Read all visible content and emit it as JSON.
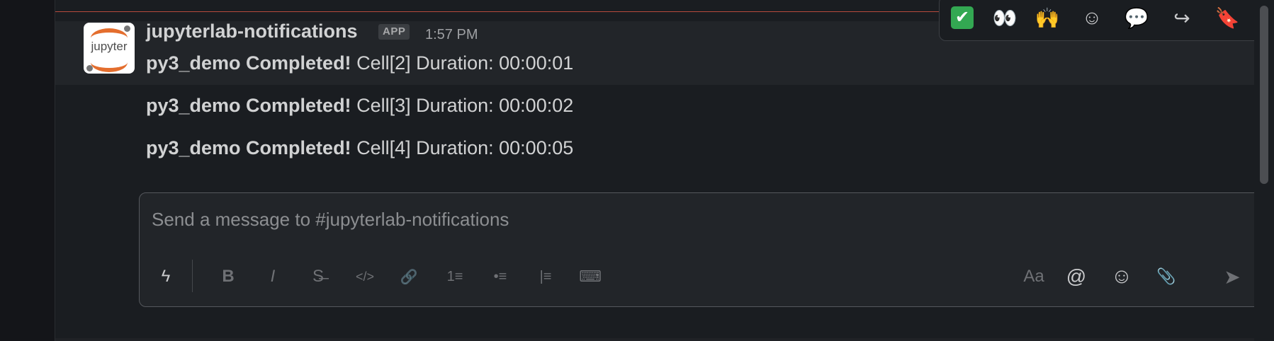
{
  "message_group": {
    "sender": "jupyterlab-notifications",
    "badge": "APP",
    "time": "1:57 PM",
    "avatar_text": "jupyter",
    "messages": [
      {
        "bold": "py3_demo Completed!",
        "text": " Cell[2] Duration: 00:00:01"
      },
      {
        "bold": "py3_demo Completed!",
        "text": " Cell[3] Duration: 00:00:02"
      },
      {
        "bold": "py3_demo Completed!",
        "text": " Cell[4] Duration: 00:00:05"
      }
    ]
  },
  "hover_actions": [
    {
      "name": "check-mark-reaction",
      "glyph": "✔"
    },
    {
      "name": "eyes-reaction",
      "glyph": "👀"
    },
    {
      "name": "raised-hands-reaction",
      "glyph": "🙌"
    },
    {
      "name": "add-reaction",
      "glyph": "☺"
    },
    {
      "name": "reply-in-thread",
      "glyph": "💬"
    },
    {
      "name": "share-message",
      "glyph": "↪"
    },
    {
      "name": "save-for-later",
      "glyph": "🔖"
    },
    {
      "name": "more-actions",
      "glyph": "⋮"
    }
  ],
  "composer": {
    "placeholder": "Send a message to #jupyterlab-notifications",
    "tools": [
      {
        "name": "shortcuts-icon",
        "glyph": "ϟ"
      },
      {
        "name": "bold-icon",
        "glyph": "B"
      },
      {
        "name": "italic-icon",
        "glyph": "I"
      },
      {
        "name": "strikethrough-icon",
        "glyph": "S̶"
      },
      {
        "name": "code-icon",
        "glyph": "</>"
      },
      {
        "name": "link-icon",
        "glyph": "🔗"
      },
      {
        "name": "ordered-list-icon",
        "glyph": "1≡"
      },
      {
        "name": "bullet-list-icon",
        "glyph": "•≡"
      },
      {
        "name": "blockquote-icon",
        "glyph": "|≡"
      },
      {
        "name": "code-block-icon",
        "glyph": "⌨"
      },
      {
        "name": "formatting-icon",
        "glyph": "Aa"
      },
      {
        "name": "mention-icon",
        "glyph": "@"
      },
      {
        "name": "emoji-icon",
        "glyph": "☺"
      },
      {
        "name": "attach-icon",
        "glyph": "📎"
      },
      {
        "name": "send-icon",
        "glyph": "➤"
      },
      {
        "name": "send-options-icon",
        "glyph": "⌄"
      }
    ]
  },
  "colors": {
    "background": "#1a1d21",
    "highlight_row": "#222529",
    "unread_line": "#b84a3d",
    "text": "#d1d2d3",
    "muted": "#8c8e91"
  }
}
